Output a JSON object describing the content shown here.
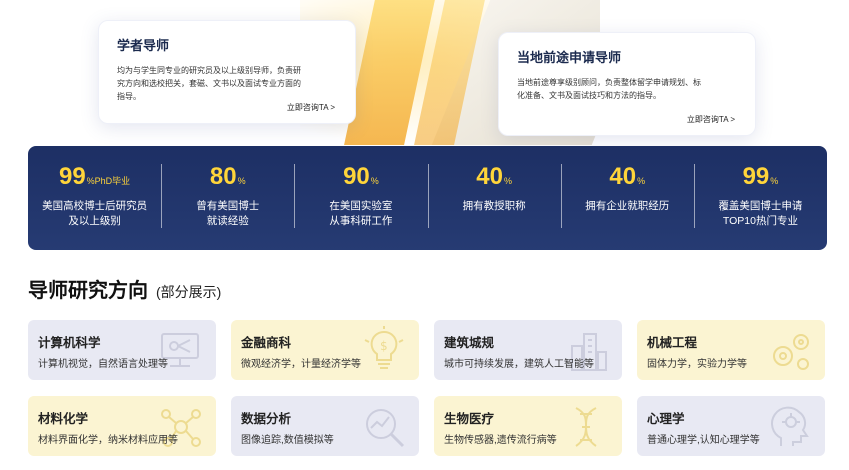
{
  "mentors": [
    {
      "title": "学者导师",
      "desc": [
        "均为与学生同专业的研究员及以上级别导师，负责研",
        "究方向和选校把关，套磁、文书以及面试专业方面的",
        "指导。"
      ],
      "link": "立即咨询TA >"
    },
    {
      "title": "当地前途申请导师",
      "desc": [
        "当地前途尊享级别顾问，负责整体留学申请规划、标",
        "化准备、文书及面试技巧和方法的指导。"
      ],
      "link": "立即咨询TA >"
    }
  ],
  "stats": [
    {
      "value": "99",
      "unit": "%PhD毕业",
      "lines": [
        "美国高校博士后研究员",
        "及以上级别"
      ]
    },
    {
      "value": "80",
      "unit": "%",
      "lines": [
        "曾有美国博士",
        "就读经验"
      ]
    },
    {
      "value": "90",
      "unit": "%",
      "lines": [
        "在美国实验室",
        "从事科研工作"
      ]
    },
    {
      "value": "40",
      "unit": "%",
      "lines": [
        "拥有教授职称"
      ]
    },
    {
      "value": "40",
      "unit": "%",
      "lines": [
        "拥有企业就职经历"
      ]
    },
    {
      "value": "99",
      "unit": "%",
      "lines": [
        "覆盖美国博士申请",
        "TOP10热门专业"
      ]
    }
  ],
  "section": {
    "title": "导师研究方向",
    "subtitle": "(部分展示)"
  },
  "fields": [
    {
      "name": "计算机科学",
      "desc": "计算机视觉，自然语言处理等",
      "bg": "purple",
      "icon": "computer-icon"
    },
    {
      "name": "金融商科",
      "desc": "微观经济学，计量经济学等",
      "bg": "yellow",
      "icon": "dollar-bulb-icon"
    },
    {
      "name": "建筑城规",
      "desc": "城市可持续发展，建筑人工智能等",
      "bg": "purple",
      "icon": "building-icon"
    },
    {
      "name": "机械工程",
      "desc": "固体力学，实验力学等",
      "bg": "yellow",
      "icon": "gears-icon"
    },
    {
      "name": "材料化学",
      "desc": "材料界面化学，纳米材料应用等",
      "bg": "yellow",
      "icon": "molecule-icon"
    },
    {
      "name": "数据分析",
      "desc": "图像追踪,数值模拟等",
      "bg": "purple",
      "icon": "magnifier-chart-icon"
    },
    {
      "name": "生物医疗",
      "desc": "生物传感器,遗传流行病等",
      "bg": "yellow",
      "icon": "dna-icon"
    },
    {
      "name": "心理学",
      "desc": "普通心理学,认知心理学等",
      "bg": "purple",
      "icon": "brain-head-icon"
    }
  ],
  "colors": {
    "navy": "#1d2f64",
    "gold": "#ffd53a",
    "purple_bg": "#e8e9f3",
    "yellow_bg": "#fbf4d2"
  }
}
